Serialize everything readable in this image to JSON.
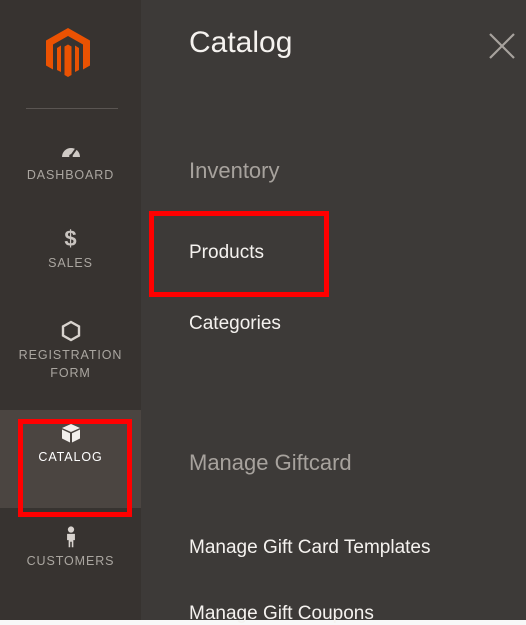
{
  "sidebar": {
    "items": [
      {
        "label": "DASHBOARD",
        "icon": "dashboard-gauge-icon"
      },
      {
        "label": "SALES",
        "icon": "dollar-icon"
      },
      {
        "label": "REGISTRATION",
        "label2": "FORM",
        "icon": "hexagon-icon"
      },
      {
        "label": "CATALOG",
        "icon": "box-icon"
      },
      {
        "label": "CUSTOMERS",
        "icon": "person-icon"
      }
    ],
    "active": "CATALOG"
  },
  "panel": {
    "title": "Catalog",
    "sections": [
      {
        "title": "Inventory",
        "links": [
          "Products",
          "Categories"
        ]
      },
      {
        "title": "Manage Giftcard",
        "links": [
          "Manage Gift Card Templates",
          "Manage Gift Coupons"
        ]
      }
    ]
  },
  "colors": {
    "accent": "#eb5202",
    "highlight": "#ff0000",
    "rail_bg": "#373330",
    "panel_bg": "#3d3a38",
    "active_bg": "#4b4541"
  },
  "glyphs": {
    "dollar": "$"
  }
}
